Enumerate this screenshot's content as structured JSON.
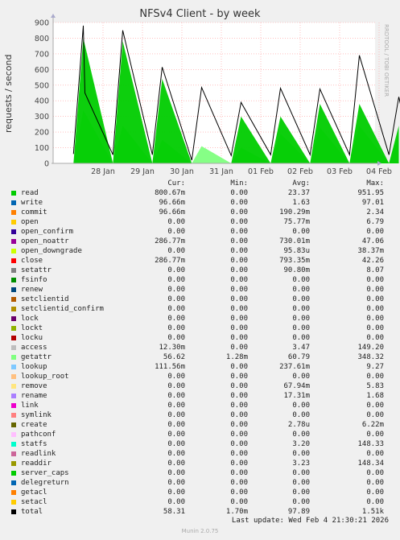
{
  "chart_data": {
    "type": "line",
    "title": "NFSv4 Client - by week",
    "ylabel": "requests / second",
    "ylim": [
      0,
      900
    ],
    "yticks": [
      "0",
      "100",
      "200",
      "300",
      "400",
      "500",
      "600",
      "700",
      "800",
      "900"
    ],
    "xticks": [
      "28 Jan",
      "29 Jan",
      "30 Jan",
      "31 Jan",
      "01 Feb",
      "02 Feb",
      "03 Feb",
      "04 Feb"
    ],
    "grid": true,
    "series": [
      {
        "name": "getattr",
        "color": "#80ff80",
        "x": [
          "27 Jan 06:00",
          "27 Jan 12:00",
          "28 Jan 06:00",
          "28 Jan 12:00",
          "29 Jan 06:00",
          "29 Jan 12:00",
          "30 Jan 06:00",
          "30 Jan 12:00",
          "31 Jan 06:00",
          "31 Jan 12:00",
          "01 Feb 06:00",
          "01 Feb 12:00",
          "02 Feb 06:00",
          "02 Feb 12:00",
          "03 Feb 06:00",
          "03 Feb 12:00",
          "04 Feb 06:00",
          "04 Feb 12:00"
        ],
        "values": [
          0,
          340,
          0,
          240,
          0,
          150,
          0,
          110,
          0,
          100,
          0,
          190,
          0,
          230,
          0,
          240,
          0,
          200
        ]
      },
      {
        "name": "read",
        "color": "#00cc00",
        "x": [
          "27 Jan 06:00",
          "27 Jan 12:00",
          "28 Jan 06:00",
          "28 Jan 12:00",
          "29 Jan 06:00",
          "29 Jan 12:00",
          "30 Jan 06:00",
          "30 Jan 12:00",
          "31 Jan 06:00",
          "31 Jan 12:00",
          "01 Feb 06:00",
          "01 Feb 12:00",
          "02 Feb 06:00",
          "02 Feb 12:00",
          "03 Feb 06:00",
          "03 Feb 12:00",
          "04 Feb 06:00",
          "04 Feb 12:00"
        ],
        "values": [
          0,
          800,
          0,
          780,
          0,
          540,
          0,
          0,
          0,
          300,
          0,
          300,
          0,
          380,
          0,
          380,
          0,
          240
        ]
      },
      {
        "name": "total",
        "color": "#000000",
        "x": [
          "27 Jan 06:00",
          "27 Jan 12:00",
          "27 Jan 13:00",
          "28 Jan 06:00",
          "28 Jan 12:00",
          "29 Jan 06:00",
          "29 Jan 12:00",
          "30 Jan 06:00",
          "30 Jan 12:00",
          "31 Jan 06:00",
          "31 Jan 12:00",
          "01 Feb 06:00",
          "01 Feb 12:00",
          "02 Feb 06:00",
          "02 Feb 12:00",
          "03 Feb 06:00",
          "03 Feb 12:00",
          "04 Feb 06:00",
          "04 Feb 12:00",
          "04 Feb 20:00"
        ],
        "values": [
          60,
          880,
          450,
          55,
          850,
          55,
          615,
          20,
          485,
          50,
          390,
          55,
          480,
          55,
          475,
          55,
          690,
          55,
          425,
          58
        ]
      }
    ]
  },
  "legend": {
    "headers": [
      "Cur:",
      "Min:",
      "Avg:",
      "Max:"
    ],
    "rows": [
      {
        "name": "read",
        "color": "#00cc00",
        "cur": "800.67m",
        "min": "0.00",
        "avg": "23.37",
        "max": "951.95"
      },
      {
        "name": "write",
        "color": "#0066b3",
        "cur": "96.66m",
        "min": "0.00",
        "avg": "1.63",
        "max": "97.01"
      },
      {
        "name": "commit",
        "color": "#ff8000",
        "cur": "96.66m",
        "min": "0.00",
        "avg": "190.29m",
        "max": "2.34"
      },
      {
        "name": "open",
        "color": "#ffcc00",
        "cur": "0.00",
        "min": "0.00",
        "avg": "75.77m",
        "max": "6.79"
      },
      {
        "name": "open_confirm",
        "color": "#330099",
        "cur": "0.00",
        "min": "0.00",
        "avg": "0.00",
        "max": "0.00"
      },
      {
        "name": "open_noattr",
        "color": "#990099",
        "cur": "286.77m",
        "min": "0.00",
        "avg": "730.01m",
        "max": "47.06"
      },
      {
        "name": "open_downgrade",
        "color": "#ccff00",
        "cur": "0.00",
        "min": "0.00",
        "avg": "95.83u",
        "max": "38.37m"
      },
      {
        "name": "close",
        "color": "#ff0000",
        "cur": "286.77m",
        "min": "0.00",
        "avg": "793.35m",
        "max": "42.26"
      },
      {
        "name": "setattr",
        "color": "#808080",
        "cur": "0.00",
        "min": "0.00",
        "avg": "90.80m",
        "max": "8.07"
      },
      {
        "name": "fsinfo",
        "color": "#008f00",
        "cur": "0.00",
        "min": "0.00",
        "avg": "0.00",
        "max": "0.00"
      },
      {
        "name": "renew",
        "color": "#00487d",
        "cur": "0.00",
        "min": "0.00",
        "avg": "0.00",
        "max": "0.00"
      },
      {
        "name": "setclientid",
        "color": "#b35a00",
        "cur": "0.00",
        "min": "0.00",
        "avg": "0.00",
        "max": "0.00"
      },
      {
        "name": "setclientid_confirm",
        "color": "#b38f00",
        "cur": "0.00",
        "min": "0.00",
        "avg": "0.00",
        "max": "0.00"
      },
      {
        "name": "lock",
        "color": "#6b006b",
        "cur": "0.00",
        "min": "0.00",
        "avg": "0.00",
        "max": "0.00"
      },
      {
        "name": "lockt",
        "color": "#8fb300",
        "cur": "0.00",
        "min": "0.00",
        "avg": "0.00",
        "max": "0.00"
      },
      {
        "name": "locku",
        "color": "#b30000",
        "cur": "0.00",
        "min": "0.00",
        "avg": "0.00",
        "max": "0.00"
      },
      {
        "name": "access",
        "color": "#bebebe",
        "cur": "12.30m",
        "min": "0.00",
        "avg": "3.47",
        "max": "149.20"
      },
      {
        "name": "getattr",
        "color": "#80ff80",
        "cur": "56.62",
        "min": "1.28m",
        "avg": "60.79",
        "max": "348.32"
      },
      {
        "name": "lookup",
        "color": "#80c9ff",
        "cur": "111.56m",
        "min": "0.00",
        "avg": "237.61m",
        "max": "9.27"
      },
      {
        "name": "lookup_root",
        "color": "#ffc080",
        "cur": "0.00",
        "min": "0.00",
        "avg": "0.00",
        "max": "0.00"
      },
      {
        "name": "remove",
        "color": "#ffe680",
        "cur": "0.00",
        "min": "0.00",
        "avg": "67.94m",
        "max": "5.83"
      },
      {
        "name": "rename",
        "color": "#aa80ff",
        "cur": "0.00",
        "min": "0.00",
        "avg": "17.31m",
        "max": "1.68"
      },
      {
        "name": "link",
        "color": "#ee00cc",
        "cur": "0.00",
        "min": "0.00",
        "avg": "0.00",
        "max": "0.00"
      },
      {
        "name": "symlink",
        "color": "#ff8080",
        "cur": "0.00",
        "min": "0.00",
        "avg": "0.00",
        "max": "0.00"
      },
      {
        "name": "create",
        "color": "#666600",
        "cur": "0.00",
        "min": "0.00",
        "avg": "2.78u",
        "max": "6.22m"
      },
      {
        "name": "pathconf",
        "color": "#ffbfff",
        "cur": "0.00",
        "min": "0.00",
        "avg": "0.00",
        "max": "0.00"
      },
      {
        "name": "statfs",
        "color": "#00ffcc",
        "cur": "0.00",
        "min": "0.00",
        "avg": "3.20",
        "max": "148.33"
      },
      {
        "name": "readlink",
        "color": "#cc6699",
        "cur": "0.00",
        "min": "0.00",
        "avg": "0.00",
        "max": "0.00"
      },
      {
        "name": "readdir",
        "color": "#999900",
        "cur": "0.00",
        "min": "0.00",
        "avg": "3.23",
        "max": "148.34"
      },
      {
        "name": "server_caps",
        "color": "#00cc00",
        "cur": "0.00",
        "min": "0.00",
        "avg": "0.00",
        "max": "0.00"
      },
      {
        "name": "delegreturn",
        "color": "#0066b3",
        "cur": "0.00",
        "min": "0.00",
        "avg": "0.00",
        "max": "0.00"
      },
      {
        "name": "getacl",
        "color": "#ff8000",
        "cur": "0.00",
        "min": "0.00",
        "avg": "0.00",
        "max": "0.00"
      },
      {
        "name": "setacl",
        "color": "#ffcc00",
        "cur": "0.00",
        "min": "0.00",
        "avg": "0.00",
        "max": "0.00"
      },
      {
        "name": "total",
        "color": "#000000",
        "cur": "58.31",
        "min": "1.70m",
        "avg": "97.89",
        "max": "1.51k"
      }
    ]
  },
  "last_update": "Last update: Wed Feb  4 21:30:21 2026",
  "side_label": "RRDTOOL / TOBI OETIKER",
  "footer": "Munin 2.0.75"
}
